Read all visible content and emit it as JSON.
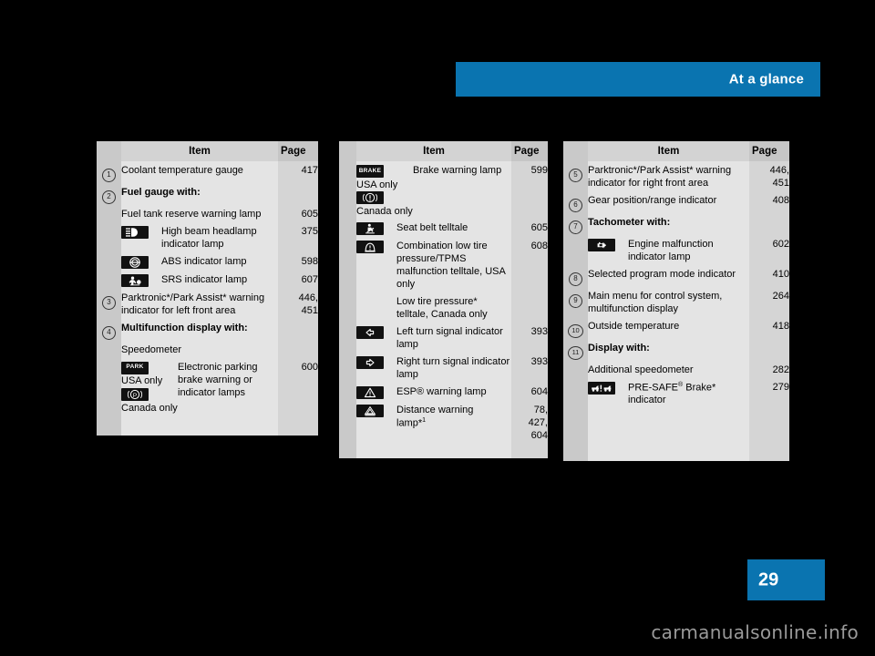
{
  "header": {
    "title": "At a glance"
  },
  "page_number": "29",
  "watermark": "carmanualsonline.info",
  "colors": {
    "accent": "#0a74b0",
    "table_item_bg": "#e4e4e4",
    "table_page_bg": "#d5d5d5",
    "gutter_bg": "#c9c9c9"
  },
  "columns": [
    {
      "id": "column-1",
      "head": {
        "item": "Item",
        "page": "Page"
      },
      "rows": [
        {
          "num": "1",
          "item": "Coolant temperature gauge",
          "page": "417"
        },
        {
          "num": "2",
          "item": "Fuel gauge with:",
          "bold": true,
          "page": ""
        },
        {
          "num": "",
          "item": "Fuel tank reserve warning lamp",
          "page": "605"
        },
        {
          "num": "",
          "icon": "high-beam-headlamp-icon",
          "item": "High beam headlamp indicator lamp",
          "page": "375"
        },
        {
          "num": "",
          "icon": "abs-indicator-icon",
          "item": "ABS indicator lamp",
          "page": "598"
        },
        {
          "num": "",
          "icon": "srs-indicator-icon",
          "item": "SRS indicator lamp",
          "page": "607"
        },
        {
          "num": "3",
          "item": "Parktronic*/Park Assist* warning indicator for left front area",
          "page": "446, 451"
        },
        {
          "num": "4",
          "item": "Multifunction display with:",
          "bold": true,
          "page": ""
        },
        {
          "num": "",
          "item": "Speedometer",
          "page": ""
        },
        {
          "num": "",
          "icon": "electronic-parking-brake-icon",
          "icon_label_usa": "PARK",
          "caption_usa": "USA only",
          "icon_label_canada": "(P)",
          "caption_canada": "Canada only",
          "item": "Electronic parking brake warning or indicator lamps",
          "page": "600"
        }
      ]
    },
    {
      "id": "column-2",
      "head": {
        "item": "Item",
        "page": "Page"
      },
      "rows": [
        {
          "num": "",
          "icon": "brake-warning-usa-icon",
          "icon_label_usa": "BRAKE",
          "caption_usa": "USA only",
          "icon_label_canada": "((!))",
          "caption_canada": "Canada only",
          "item": "Brake warning lamp",
          "page": "599"
        },
        {
          "num": "",
          "icon": "seat-belt-telltale-icon",
          "item": "Seat belt telltale",
          "page": "605"
        },
        {
          "num": "",
          "icon": "low-tire-pressure-tpms-icon",
          "item": "Combination low tire pressure/TPMS malfunction telltale, USA only",
          "page": "608"
        },
        {
          "num": "",
          "item": "Low tire pressure* telltale, Canada only",
          "page": ""
        },
        {
          "num": "",
          "icon": "left-turn-signal-icon",
          "item": "Left turn signal indicator lamp",
          "page": "393"
        },
        {
          "num": "",
          "icon": "right-turn-signal-icon",
          "item": "Right turn signal indicator lamp",
          "page": "393"
        },
        {
          "num": "",
          "icon": "esp-warning-icon",
          "item": "ESP® warning lamp",
          "page": "604"
        },
        {
          "num": "",
          "icon": "distance-warning-icon",
          "item": "Distance warning lamp*1",
          "page": "78, 427, 604"
        }
      ]
    },
    {
      "id": "column-3",
      "head": {
        "item": "Item",
        "page": "Page"
      },
      "rows": [
        {
          "num": "5",
          "item": "Parktronic*/Park Assist* warning indicator for right front area",
          "page": "446, 451"
        },
        {
          "num": "6",
          "item": "Gear position/range indicator",
          "page": "408"
        },
        {
          "num": "7",
          "item": "Tachometer with:",
          "bold": true,
          "page": ""
        },
        {
          "num": "",
          "icon": "engine-malfunction-icon",
          "item": "Engine malfunction indicator lamp",
          "page": "602"
        },
        {
          "num": "8",
          "item": "Selected program mode indicator",
          "page": "410"
        },
        {
          "num": "9",
          "item": "Main menu for control system, multifunction display",
          "page": "264"
        },
        {
          "num": "10",
          "item": "Outside temperature",
          "page": "418"
        },
        {
          "num": "11",
          "item": "Display with:",
          "bold": true,
          "page": ""
        },
        {
          "num": "",
          "item": "Additional speedometer",
          "page": "282"
        },
        {
          "num": "",
          "icon": "pre-safe-brake-icon",
          "item": "PRE-SAFE® Brake* indicator",
          "page": "279"
        }
      ]
    }
  ],
  "text": {
    "c1": {
      "head_item": "Item",
      "head_page": "Page",
      "r1_item": "Coolant temperature gauge",
      "r1_page": "417",
      "r2_item": "Fuel gauge with:",
      "r3_item": "Fuel tank reserve warning lamp",
      "r3_page": "605",
      "r4_item": "High beam headlamp indicator lamp",
      "r4_page": "375",
      "r5_item": "ABS indicator lamp",
      "r5_page": "598",
      "r6_item": "SRS indicator lamp",
      "r6_page": "607",
      "r7_item": "Parktronic*/Park Assist* warning indicator for left front area",
      "r7_page1": "446,",
      "r7_page2": "451",
      "r8_item": "Multifunction display with:",
      "r9_item": "Speedometer",
      "r10_item": "Electronic parking brake warning or indicator lamps",
      "r10_page": "600",
      "r10_usa": "USA only",
      "r10_canada": "Canada only",
      "n1": "1",
      "n2": "2",
      "n3": "3",
      "n4": "4"
    },
    "c2": {
      "head_item": "Item",
      "head_page": "Page",
      "r1_item": "Brake warning lamp",
      "r1_page": "599",
      "r1_usa": "USA only",
      "r1_canada": "Canada only",
      "r2_item": "Seat belt telltale",
      "r2_page": "605",
      "r3_item": "Combination low tire pressure/TPMS malfunction telltale, USA only",
      "r3_page": "608",
      "r4_item": "Low tire pressure* telltale, Canada only",
      "r5_item": "Left turn signal indicator lamp",
      "r5_page": "393",
      "r6_item": "Right turn signal indicator lamp",
      "r6_page": "393",
      "r7_item": "ESP® warning lamp",
      "r7_page": "604",
      "r8_item_a": "Distance warning",
      "r8_item_b": "lamp*",
      "r8_sup": "1",
      "r8_page1": "78,",
      "r8_page2": "427,",
      "r8_page3": "604"
    },
    "c3": {
      "head_item": "Item",
      "head_page": "Page",
      "r1_item": "Parktronic*/Park Assist* warning indicator for right front area",
      "r1_page1": "446,",
      "r1_page2": "451",
      "r2_item": "Gear position/range indicator",
      "r2_page": "408",
      "r3_item": "Tachometer with:",
      "r4_item": "Engine malfunction indicator lamp",
      "r4_page": "602",
      "r5_item": "Selected program mode indicator",
      "r5_page": "410",
      "r6_item": "Main menu for control system, multifunction display",
      "r6_page": "264",
      "r7_item": "Outside temperature",
      "r7_page": "418",
      "r8_item": "Display with:",
      "r9_item": "Additional speedometer",
      "r9_page": "282",
      "r10_item_a": "PRE-SAFE",
      "r10_item_reg": "®",
      "r10_item_b": " Brake* indicator",
      "r10_page": "279",
      "n5": "5",
      "n6": "6",
      "n7": "7",
      "n8": "8",
      "n9": "9",
      "n10": "10",
      "n11": "11"
    },
    "icon_labels": {
      "park": "PARK",
      "brake": "BRAKE"
    }
  }
}
